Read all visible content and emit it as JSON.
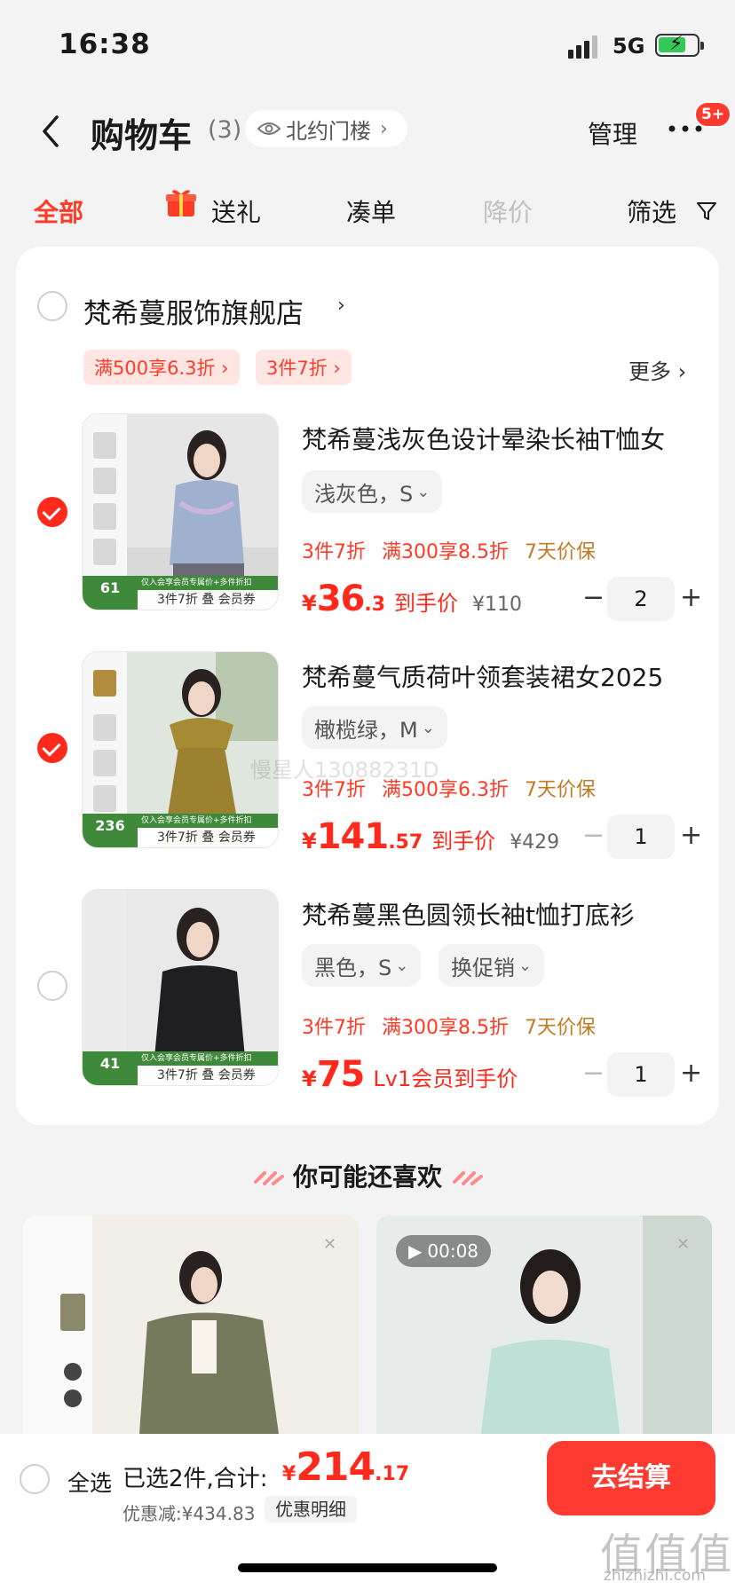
{
  "status_bar": {
    "time": "16:38",
    "network": "5G"
  },
  "header": {
    "title": "购物车",
    "count": "(3)",
    "location": "北约门楼",
    "manage": "管理",
    "badge": "5+"
  },
  "tabs": [
    {
      "label": "全部",
      "state": "active"
    },
    {
      "label": "送礼",
      "state": "normal"
    },
    {
      "label": "凑单",
      "state": "normal"
    },
    {
      "label": "降价",
      "state": "disabled"
    },
    {
      "label": "筛选",
      "state": "normal"
    }
  ],
  "store": {
    "name": "梵希蔓服饰旗舰店",
    "promos": [
      "满500享6.3折 ›",
      "3件7折 ›"
    ],
    "more": "更多 ›"
  },
  "products": [
    {
      "selected": true,
      "title": "梵希蔓浅灰色设计晕染长袖T恤女",
      "sku": "浅灰色，S",
      "promos": [
        "3件7折",
        "满300享8.5折"
      ],
      "guarantee": "7天价保",
      "price_currency": "¥",
      "price_int": "36",
      "price_dec": ".3",
      "price_label": "到手价",
      "orig_price": "¥110",
      "quantity": "2",
      "thumb_count": "61",
      "thumb_tagline": "3件7折 叠 会员券",
      "thumb_strip": "仅入会享会员专属价+多件折扣"
    },
    {
      "selected": true,
      "title": "梵希蔓气质荷叶领套装裙女2025",
      "sku": "橄榄绿，M",
      "promos": [
        "3件7折",
        "满500享6.3折"
      ],
      "guarantee": "7天价保",
      "price_currency": "¥",
      "price_int": "141",
      "price_dec": ".57",
      "price_label": "到手价",
      "orig_price": "¥429",
      "quantity": "1",
      "thumb_count": "236",
      "thumb_tagline": "3件7折 叠 会员券",
      "thumb_strip": "仅入会享会员专属价+多件折扣"
    },
    {
      "selected": false,
      "title": "梵希蔓黑色圆领长袖t恤打底衫",
      "sku": "黑色，S",
      "sku2": "换促销",
      "promos": [
        "3件7折",
        "满300享8.5折"
      ],
      "guarantee": "7天价保",
      "price_currency": "¥",
      "price_int": "75",
      "price_dec": "",
      "price_label": "Lv1会员到手价",
      "orig_price": "",
      "quantity": "1",
      "thumb_count": "41",
      "thumb_tagline": "3件7折 叠 会员券",
      "thumb_strip": "仅入会享会员专属价+多件折扣"
    }
  ],
  "watermark": "慢星人13088231D",
  "recommend": {
    "title": "你可能还喜欢",
    "video_time": "00:08"
  },
  "bottom": {
    "select_all": "全选",
    "selected_text": "已选2件,合计:",
    "total_currency": "¥",
    "total_int": "214",
    "total_dec": ".17",
    "discount": "优惠减:¥434.83",
    "detail": "优惠明细",
    "checkout": "去结算"
  },
  "site_mark": "值值值",
  "site_url": "zhizhizhi.com",
  "colors": {
    "accent": "#ff3a26",
    "gold": "#c07a22",
    "bg": "#f3f3f3"
  }
}
